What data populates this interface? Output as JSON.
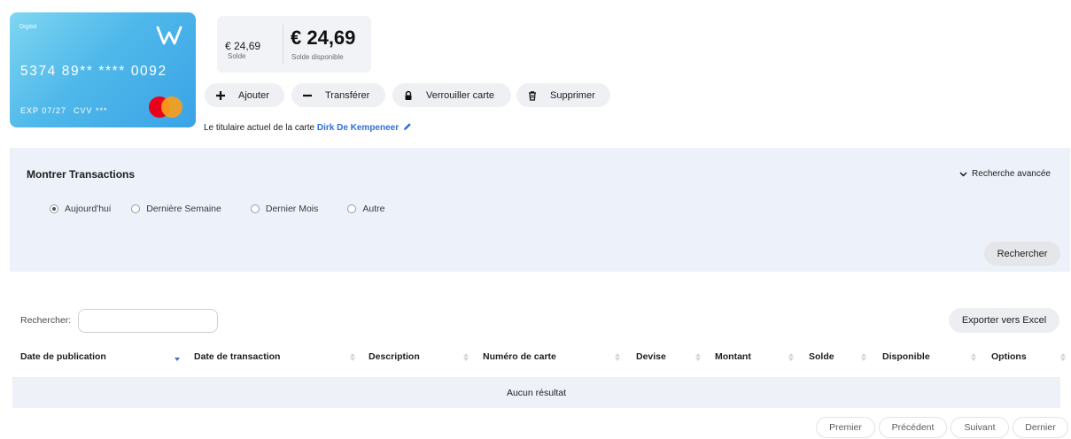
{
  "card": {
    "tag": "Digital",
    "number": "5374 89** **** 0092",
    "exp": "EXP 07/27",
    "cvv": "CVV ***",
    "logo_icon": "w-logo-icon",
    "network_icon": "mastercard-icon"
  },
  "balance": {
    "amount": "€ 24,69",
    "amount_label": "Solde",
    "available": "€ 24,69",
    "available_label": "Solde disponible"
  },
  "actions": {
    "add": "Ajouter",
    "transfer": "Transférer",
    "lock": "Verrouiller carte",
    "delete": "Supprimer"
  },
  "holder": {
    "prefix": "Le titulaire actuel de la carte",
    "name": "Dirk De Kempeneer"
  },
  "filter": {
    "title": "Montrer Transactions",
    "advanced": "Recherche avancée",
    "options": [
      "Aujourd'hui",
      "Dernière Semaine",
      "Dernier Mois",
      "Autre"
    ],
    "selected": "Aujourd'hui",
    "search_button": "Rechercher"
  },
  "table": {
    "search_label": "Rechercher:",
    "search_value": "",
    "export_button": "Exporter vers Excel",
    "columns": [
      "Date de publication",
      "Date de transaction",
      "Description",
      "Numéro de carte",
      "Devise",
      "Montant",
      "Solde",
      "Disponible",
      "Options"
    ],
    "sorted_column": "Date de publication",
    "empty_message": "Aucun résultat"
  },
  "pagination": {
    "first": "Premier",
    "previous": "Précédent",
    "next": "Suivant",
    "last": "Dernier"
  },
  "colors": {
    "card_gradient_start": "#7fd6f2",
    "card_gradient_end": "#3aa3e6",
    "panel_bg": "#edf1f9",
    "link": "#2f6fd6",
    "sort_active": "#3b6fd9"
  }
}
